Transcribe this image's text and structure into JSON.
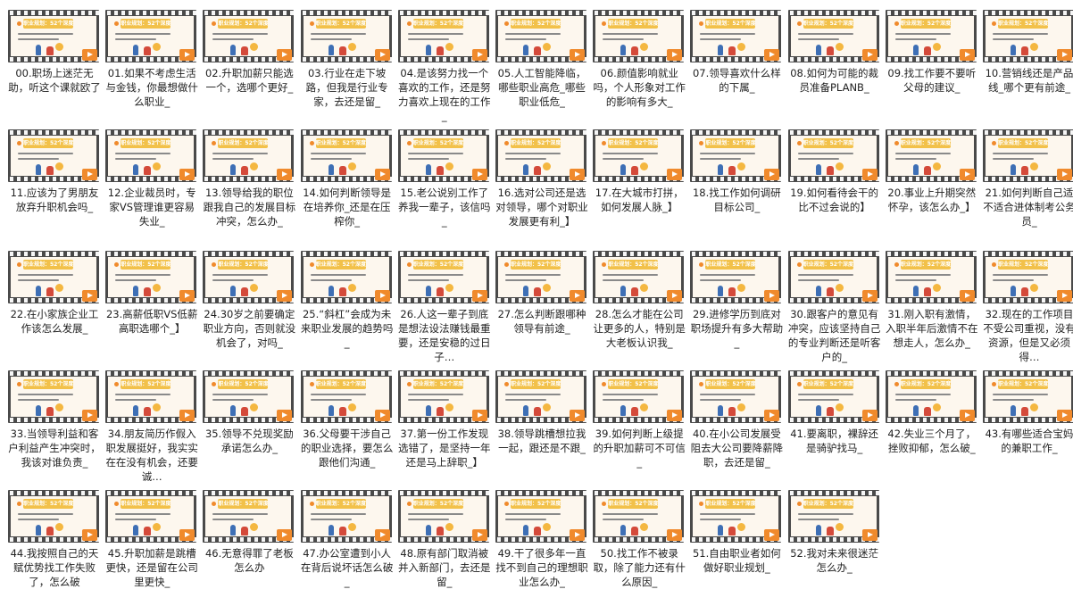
{
  "tile_banner": "职业规划：52个深度解答",
  "colors": {
    "film_strip": "#4a4a4a",
    "banner": "#f2c14a",
    "play_badge": "#f08a2c",
    "frame_bg": "#fdf7ee"
  },
  "icons": {
    "play": "play-icon",
    "figure": "illustration-figure"
  },
  "videos": [
    {
      "caption": "00.职场上迷茫无助，听这个课就欧了"
    },
    {
      "caption": "01.如果不考虑生活与金钱，你最想做什么职业_"
    },
    {
      "caption": "02.升职加薪只能选一个，选哪个更好_"
    },
    {
      "caption": "03.行业在走下坡路，但我是行业专家，去还是留_"
    },
    {
      "caption": "04.是该努力找一个喜欢的工作，还是努力喜欢上现在的工作_"
    },
    {
      "caption": "05.人工智能降临，哪些职业高危_哪些职业低危_"
    },
    {
      "caption": "06.颜值影响就业吗，个人形象对工作的影响有多大_"
    },
    {
      "caption": "07.领导喜欢什么样的下属_"
    },
    {
      "caption": "08.如何为可能的裁员准备PLANB_"
    },
    {
      "caption": "09.找工作要不要听父母的建议_"
    },
    {
      "caption": "10.营销线还是产品线_哪个更有前途_"
    },
    {
      "caption": "11.应该为了男朋友放弃升职机会吗_"
    },
    {
      "caption": "12.企业裁员时，专家VS管理谁更容易失业_"
    },
    {
      "caption": "13.领导给我的职位跟我自己的发展目标冲突，怎么办_"
    },
    {
      "caption": "14.如何判断领导是在培养你_还是在压榨你_"
    },
    {
      "caption": "15.老公说别工作了养我一辈子，该信吗_"
    },
    {
      "caption": "16.选对公司还是选对领导，哪个对职业发展更有利_】"
    },
    {
      "caption": "17.在大城市打拼，如何发展人脉_】"
    },
    {
      "caption": "18.找工作如何调研目标公司_"
    },
    {
      "caption": "19.如何看待会干的比不过会说的】"
    },
    {
      "caption": "20.事业上升期突然怀孕，该怎么办_】"
    },
    {
      "caption": "21.如何判断自己适不适合进体制考公务员_"
    },
    {
      "caption": "22.在小家族企业工作该怎么发展_"
    },
    {
      "caption": "23.高薪低职VS低薪高职选哪个_】"
    },
    {
      "caption": "24.30岁之前要确定职业方向，否则就没机会了，对吗_"
    },
    {
      "caption": "25.“斜杠”会成为未来职业发展的趋势吗_"
    },
    {
      "caption": "26.人这一辈子到底是想法设法赚钱最重要，还是安稳的过日子…"
    },
    {
      "caption": "27.怎么判断跟哪种领导有前途_"
    },
    {
      "caption": "28.怎么才能在公司让更多的人，特别是大老板认识我_"
    },
    {
      "caption": "29.进修学历到底对职场提升有多大帮助_"
    },
    {
      "caption": "30.跟客户的意见有冲突，应该坚持自己的专业判断还是听客户的_"
    },
    {
      "caption": "31.刚入职有激情，入职半年后激情不在想走人，怎么办_"
    },
    {
      "caption": "32.现在的工作项目不受公司重视，没有资源，但是又必须得…"
    },
    {
      "caption": "33.当领导利益和客户利益产生冲突时，我该对谁负责_"
    },
    {
      "caption": "34.朋友简历作假入职发展挺好，我实实在在没有机会，还要诚…"
    },
    {
      "caption": "35.领导不兑现奖励承诺怎么办_"
    },
    {
      "caption": "36.父母要干涉自己的职业选择，要怎么跟他们沟通_"
    },
    {
      "caption": "37.第一份工作发现选错了，是坚持一年还是马上辞职_】"
    },
    {
      "caption": "38.领导跳槽想拉我一起，跟还是不跟_"
    },
    {
      "caption": "39.如何判断上级提的升职加薪可不可信_"
    },
    {
      "caption": "40.在小公司发展受阻去大公司要降薪降职，去还是留_"
    },
    {
      "caption": "41.要离职，裸辞还是骑驴找马_"
    },
    {
      "caption": "42.失业三个月了，挫败抑郁，怎么破_"
    },
    {
      "caption": "43.有哪些适合宝妈的兼职工作_"
    },
    {
      "caption": "44.我按照自己的天赋优势找工作失败了，怎么破"
    },
    {
      "caption": "45.升职加薪是跳槽更快，还是留在公司里更快_"
    },
    {
      "caption": "46.无意得罪了老板怎么办"
    },
    {
      "caption": "47.办公室遭到小人在背后说坏话怎么破_"
    },
    {
      "caption": "48.原有部门取消被并入新部门，去还是留_"
    },
    {
      "caption": "49.干了很多年一直找不到自己的理想职业怎么办_"
    },
    {
      "caption": "50.找工作不被录取，除了能力还有什么原因_"
    },
    {
      "caption": "51.自由职业者如何做好职业规划_"
    },
    {
      "caption": "52.我对未来很迷茫怎么办_"
    }
  ]
}
